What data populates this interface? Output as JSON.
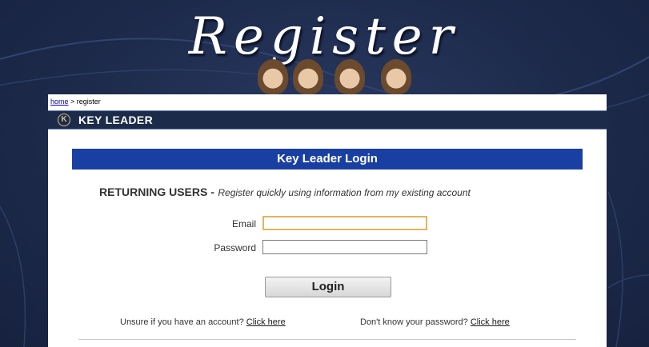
{
  "header": {
    "title": "Register",
    "faces_icon": "faces-banner-icon"
  },
  "breadcrumb": {
    "home": "home",
    "separator": " > ",
    "current": "register"
  },
  "section": {
    "logo_glyph": "K",
    "title": "KEY LEADER"
  },
  "login": {
    "header": "Key Leader Login",
    "returning_strong": "RETURNING USERS -",
    "returning_em": "Register quickly using information from my existing account",
    "email_label": "Email",
    "email_value": "",
    "password_label": "Password",
    "password_value": "",
    "login_button": "Login",
    "unsure_text": "Unsure if you have an account?",
    "unsure_link": "Click here",
    "forgot_text": "Don't know your password?",
    "forgot_link": "Click here"
  },
  "colors": {
    "page_bg": "#1e2c4e",
    "header_bar": "#1a3fa3",
    "section_bar": "#1d2b4a",
    "focus_border": "#e2b55c"
  }
}
